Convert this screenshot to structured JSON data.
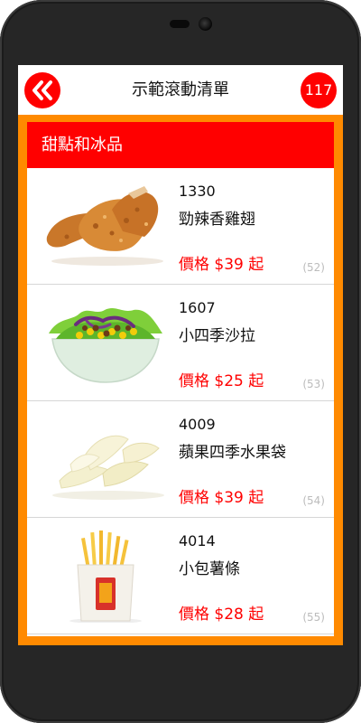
{
  "app": {
    "title": "示範滾動清單",
    "count": "117"
  },
  "section": {
    "header": "甜點和冰品"
  },
  "items": [
    {
      "code": "1330",
      "name": "勁辣香雞翅",
      "price": "價格 $39 起",
      "index": "(52)",
      "image_icon": "fried-chicken-wings"
    },
    {
      "code": "1607",
      "name": "小四季沙拉",
      "price": "價格 $25 起",
      "index": "(53)",
      "image_icon": "salad-bowl"
    },
    {
      "code": "4009",
      "name": "蘋果四季水果袋",
      "price": "價格 $39 起",
      "index": "(54)",
      "image_icon": "apple-slices"
    },
    {
      "code": "4014",
      "name": "小包薯條",
      "price": "價格 $28 起",
      "index": "(55)",
      "image_icon": "french-fries"
    }
  ],
  "colors": {
    "accent": "#ff0000",
    "border": "#ff8a00",
    "device": "#262626"
  }
}
